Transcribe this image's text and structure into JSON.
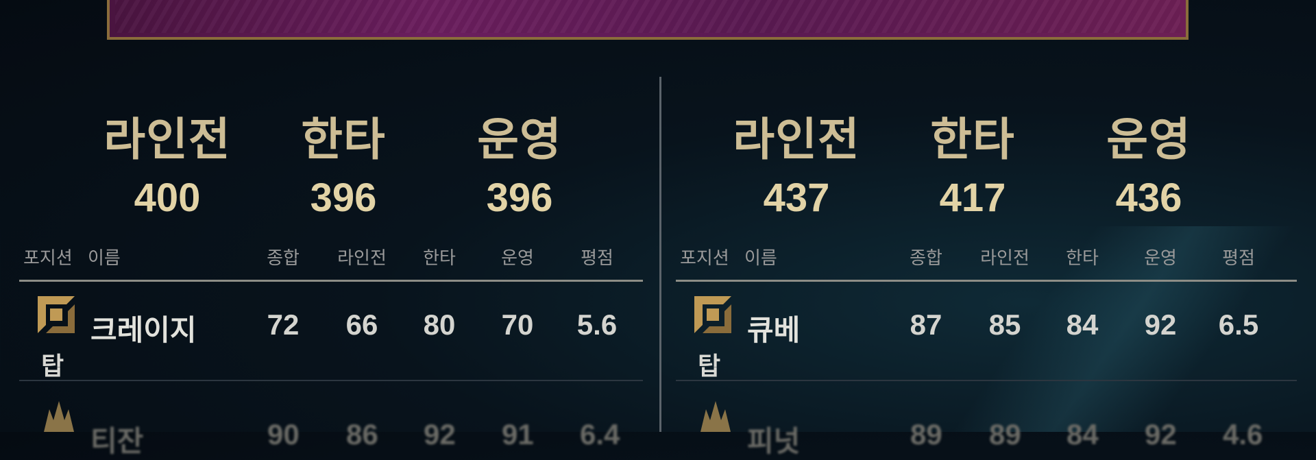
{
  "left_team": {
    "summary": [
      {
        "label": "라인전",
        "value": "400"
      },
      {
        "label": "한타",
        "value": "396"
      },
      {
        "label": "운영",
        "value": "396"
      }
    ],
    "table": {
      "headers": {
        "position": "포지션",
        "name": "이름",
        "cols": [
          "종합",
          "라인전",
          "한타",
          "운영",
          "평점"
        ]
      },
      "rows": [
        {
          "position": "탑",
          "icon": "top-lane-icon",
          "name": "크레이지",
          "stats": [
            "72",
            "66",
            "80",
            "70",
            "5.6"
          ]
        },
        {
          "icon": "jungle-lane-icon",
          "partial": true,
          "name": "티잔",
          "stats": [
            "90",
            "86",
            "92",
            "91",
            "6.4"
          ]
        }
      ]
    }
  },
  "right_team": {
    "summary": [
      {
        "label": "라인전",
        "value": "437"
      },
      {
        "label": "한타",
        "value": "417"
      },
      {
        "label": "운영",
        "value": "436"
      }
    ],
    "table": {
      "headers": {
        "position": "포지션",
        "name": "이름",
        "cols": [
          "종합",
          "라인전",
          "한타",
          "운영",
          "평점"
        ]
      },
      "rows": [
        {
          "position": "탑",
          "icon": "top-lane-icon",
          "name": "큐베",
          "stats": [
            "87",
            "85",
            "84",
            "92",
            "6.5"
          ]
        },
        {
          "icon": "jungle-lane-icon",
          "partial": true,
          "name": "피넛",
          "stats": [
            "89",
            "89",
            "84",
            "92",
            "4.6"
          ]
        }
      ]
    }
  },
  "colors": {
    "gold": "#cdbd95",
    "banner": "#6b1e5e",
    "frame": "#8a6c3b",
    "background": "#08131c"
  }
}
